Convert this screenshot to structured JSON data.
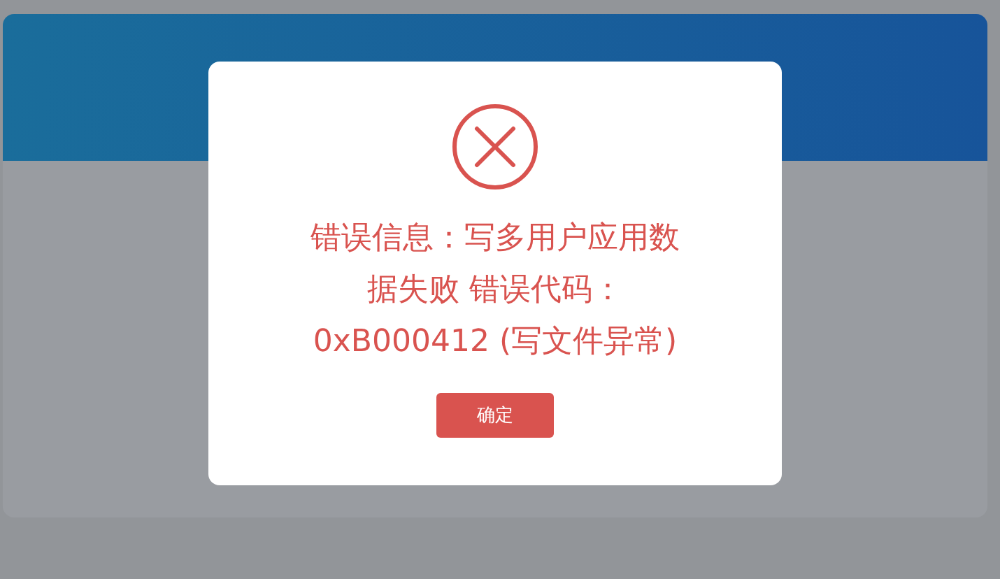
{
  "dialog": {
    "kind": "error",
    "message_lines": [
      "错误信息：写多用户应用数",
      "据失败 错误代码：",
      "0xB000412 (写文件异常)"
    ],
    "buttons": [
      "确定"
    ]
  }
}
